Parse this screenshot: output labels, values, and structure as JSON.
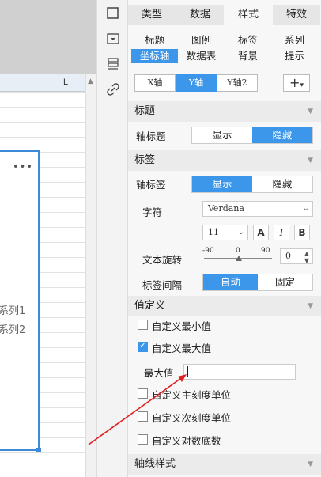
{
  "left": {
    "column_label": "L",
    "more_label": "•••",
    "series": [
      "系列1",
      "系列2"
    ]
  },
  "tabs": [
    {
      "label": "类型"
    },
    {
      "label": "数据"
    },
    {
      "label": "样式",
      "active": true
    },
    {
      "label": "特效"
    }
  ],
  "subtabs": [
    "标题",
    "图例",
    "标签",
    "系列",
    "坐标轴",
    "数据表",
    "背景",
    "提示"
  ],
  "axis_tabs": [
    "X轴",
    "Y轴",
    "Y轴2"
  ],
  "add_label": "+",
  "add_chevron": "▾",
  "sections": {
    "title": "标题",
    "label": "标签",
    "valdef": "值定义",
    "axisline": "轴线样式"
  },
  "axis_title": {
    "label": "轴标题",
    "show": "显示",
    "hide": "隐藏",
    "selected": "隐藏"
  },
  "axis_label": {
    "label": "轴标签",
    "show": "显示",
    "hide": "隐藏",
    "selected": "显示"
  },
  "font": {
    "label": "字符",
    "family": "Verdana",
    "size": "11",
    "color_glyph": "A",
    "italic_glyph": "I",
    "bold_glyph": "B"
  },
  "rotation": {
    "label": "文本旋转",
    "min": "-90",
    "mid": "0",
    "max": "90",
    "value": "0"
  },
  "spacing": {
    "label": "标签间隔",
    "auto": "自动",
    "fixed": "固定",
    "selected": "自动"
  },
  "value_def": {
    "custom_min": "自定义最小值",
    "custom_max": "自定义最大值",
    "max_label": "最大值",
    "max_value": "",
    "major_unit": "自定义主刻度单位",
    "minor_unit": "自定义次刻度单位",
    "log_base": "自定义对数底数",
    "checked": [
      "自定义最大值"
    ]
  },
  "colors": {
    "accent": "#3c96ea",
    "arrow": "#e02020"
  }
}
